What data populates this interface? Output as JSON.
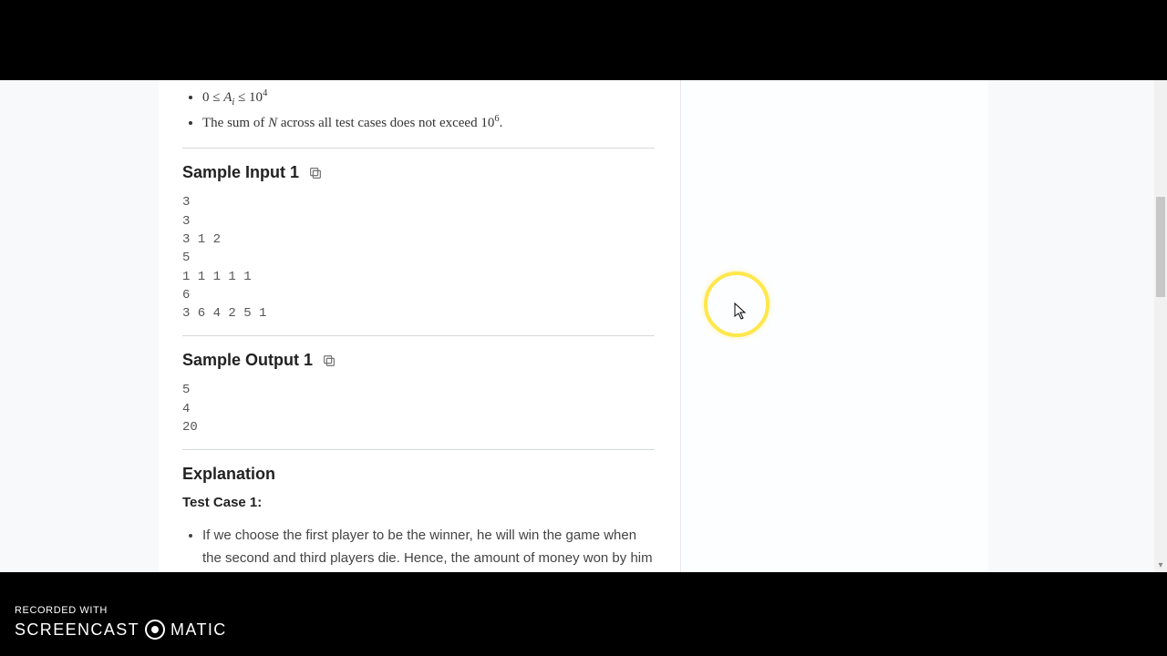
{
  "constraints": {
    "item1_html": "0 ≤ <span class='math-i'>A<span class='sub'>i</span></span> ≤ 10<span class='sup'>4</span>",
    "item2_prefix": "The sum of ",
    "item2_var": "N",
    "item2_mid": " across all test cases does not exceed ",
    "item2_limit_base": "10",
    "item2_limit_exp": "6",
    "item2_suffix": "."
  },
  "sample_input": {
    "heading": "Sample Input 1",
    "content": "3\n3\n3 1 2\n5\n1 1 1 1 1\n6\n3 6 4 2 5 1"
  },
  "sample_output": {
    "heading": "Sample Output 1",
    "content": "5\n4\n20"
  },
  "explanation": {
    "heading": "Explanation",
    "case_label": "Test Case 1:",
    "bullet1": "If we choose the first player to be the winner, he will win the game when the second and third players die. Hence, the amount of money won by him will be"
  },
  "watermark": {
    "top": "RECORDED WITH",
    "brand_left": "SCREENCAST",
    "brand_right": "MATIC"
  }
}
